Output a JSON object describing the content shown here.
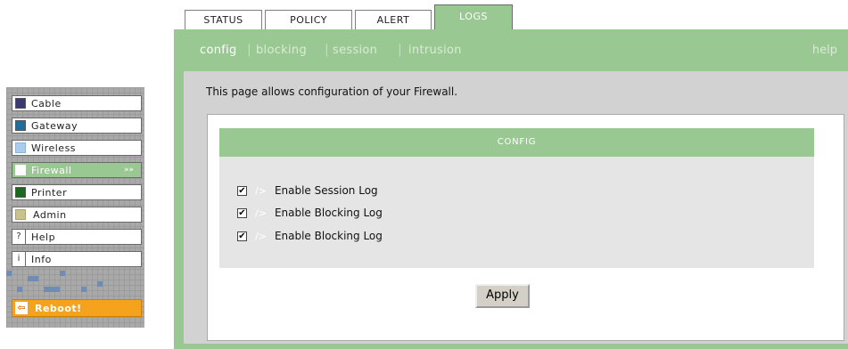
{
  "tabs": [
    {
      "label": "STATUS"
    },
    {
      "label": "POLICY"
    },
    {
      "label": "ALERT"
    },
    {
      "label": "LOGS"
    }
  ],
  "subnav": {
    "items": [
      {
        "label": "config"
      },
      {
        "label": "blocking"
      },
      {
        "label": "session"
      },
      {
        "label": "intrusion"
      }
    ],
    "separator": "|",
    "help": "help"
  },
  "sidebar": {
    "items": [
      {
        "label": "Cable",
        "color": "#3b3a72"
      },
      {
        "label": "Gateway",
        "color": "#1f6e9c"
      },
      {
        "label": "Wireless",
        "color": "#a9cdf0"
      },
      {
        "label": "Firewall",
        "color": "#ffffff",
        "arrow": "»»"
      },
      {
        "label": "Printer",
        "color": "#1b6a1b"
      },
      {
        "label": "Admin",
        "color": "#c9c28e"
      },
      {
        "label": "Help",
        "glyph": "?"
      },
      {
        "label": "Info",
        "glyph": "i"
      }
    ],
    "reboot": {
      "label": "Reboot!",
      "icon": "⇦"
    }
  },
  "page": {
    "intro": "This page allows configuration of your Firewall.",
    "section_title": "CONFIG",
    "options": [
      {
        "label": "Enable Session Log",
        "checked": true
      },
      {
        "label": "Enable Blocking Log",
        "checked": true
      },
      {
        "label": "Enable Blocking Log",
        "checked": true
      }
    ],
    "checkmark": "✔",
    "deco": "/>",
    "apply": "Apply"
  },
  "colors": {
    "accent": "#99c892",
    "content_bg": "#d2d2d2",
    "reboot": "#f5a31c"
  }
}
